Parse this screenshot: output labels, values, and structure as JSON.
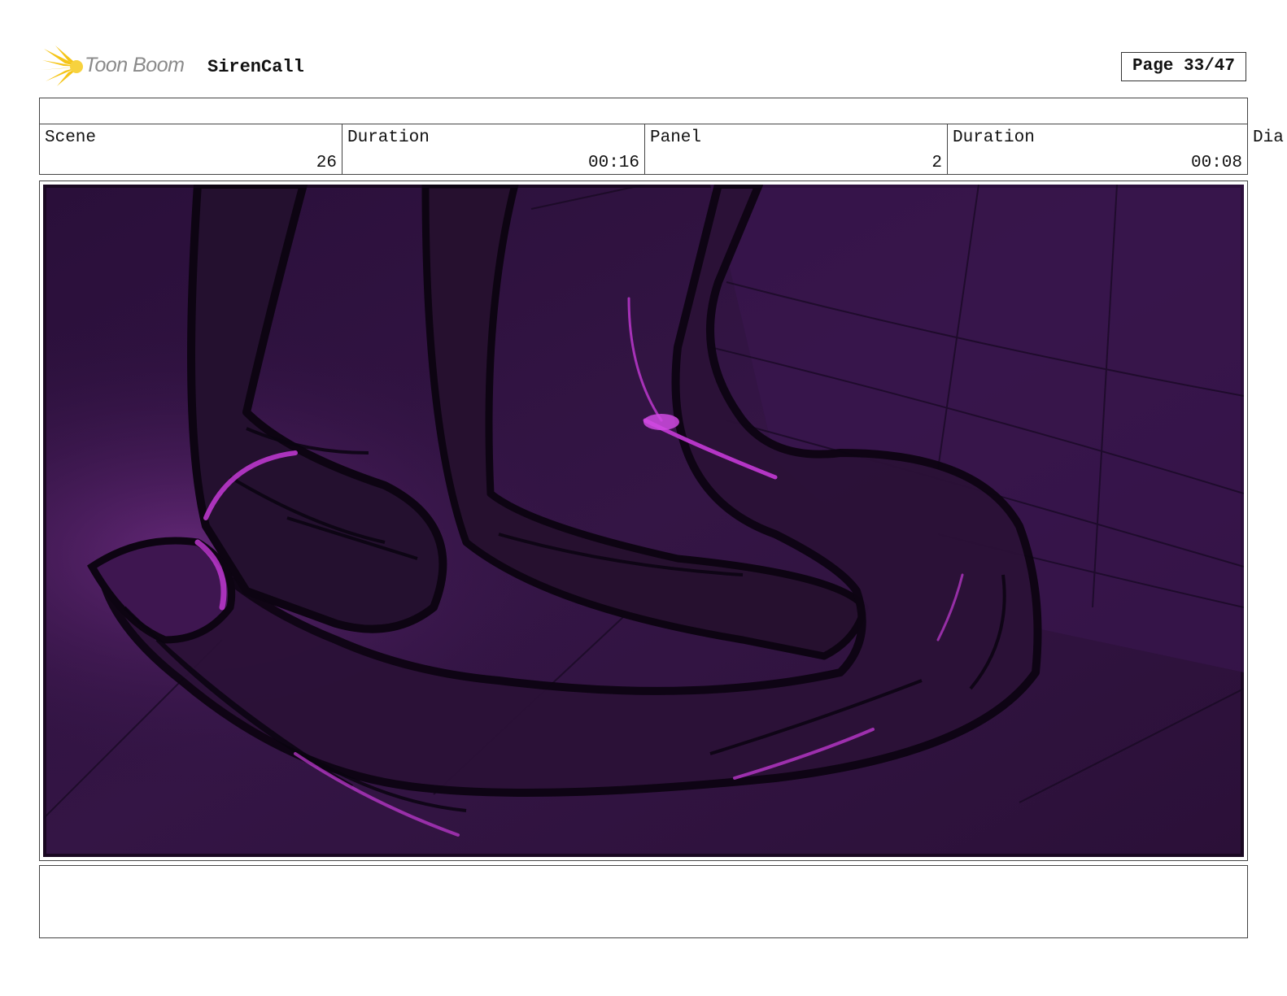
{
  "header": {
    "logo_text": "Toon Boom",
    "project_name": "SirenCall",
    "page_label": "Page 33/47"
  },
  "info": {
    "scene_label": "Scene",
    "scene_value": "26",
    "scene_duration_label": "Duration",
    "scene_duration_value": "00:16",
    "panel_label": "Panel",
    "panel_value": "2",
    "panel_duration_label": "Duration",
    "panel_duration_value": "00:08",
    "dialog_label": "Dia"
  },
  "colors": {
    "panel_bg": "#2e1240",
    "sketch_line": "#0f0614",
    "highlight": "#c43ad6",
    "logo_accent": "#f5c518"
  }
}
